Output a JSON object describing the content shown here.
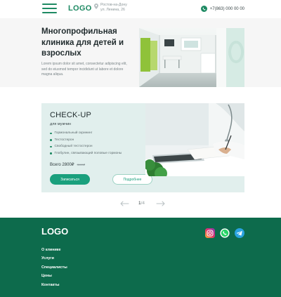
{
  "header": {
    "logo": "LOGO",
    "address_line1": "Ростов-на-Дону",
    "address_line2": "ул. Ленина, 26",
    "phone": "+7(863) 000 00 00"
  },
  "hero": {
    "title": "Многопрофильная клиника для детей и взрослых",
    "description": "Lorem ipsum dolor sit amet, consectetur adipiscing elit, sed do eiusmod tempor incididunt ut labore et dolore magna aliqua."
  },
  "checkup": {
    "title": "CHECK-UP",
    "subtitle": "для мужчин",
    "items": [
      "Гормональный скрининг",
      "Тестостерон",
      "Свободный тестостерон",
      "Глобулин, связывающий половые гормоны"
    ],
    "price": "Всего 2800₽",
    "old_price": "3100₽",
    "primary_button": "Записаться",
    "secondary_button": "Подробнее"
  },
  "pager": {
    "current": "1",
    "total": "/4"
  },
  "footer": {
    "logo": "LOGO",
    "nav": [
      "О клинике",
      "Услуги",
      "Специалисты",
      "Цены",
      "Контакты"
    ]
  },
  "colors": {
    "brand_green": "#1e8a63",
    "button_green": "#1aa07d",
    "footer_bg": "#0d6b4c",
    "card_bg": "#e1efed"
  },
  "icons": [
    "menu-icon",
    "location-pin-icon",
    "whatsapp-icon",
    "arrow-left-icon",
    "arrow-right-icon",
    "instagram-icon",
    "telegram-icon"
  ]
}
